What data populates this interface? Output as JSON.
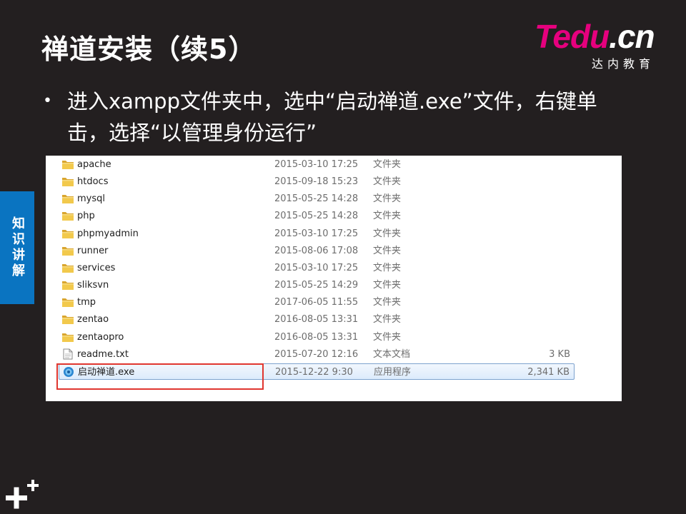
{
  "slide": {
    "title": "禅道安装（续5）",
    "bullet_text": "进入xampp文件夹中，选中“启动禅道.exe”文件，右键单击，选择“以管理身份运行”",
    "bullet_symbol": "•",
    "side_tab_label": "知识讲解"
  },
  "logo": {
    "main_part1": "T",
    "main_part2": "edu",
    "main_part3": ".cn",
    "subtitle": "达内教育",
    "colors": {
      "magenta": "#e6007e",
      "white": "#ffffff"
    }
  },
  "explorer": {
    "files": [
      {
        "name": "apache",
        "date": "2015-03-10 17:25",
        "type": "文件夹",
        "size": "",
        "icon": "folder-icon"
      },
      {
        "name": "htdocs",
        "date": "2015-09-18 15:23",
        "type": "文件夹",
        "size": "",
        "icon": "folder-icon"
      },
      {
        "name": "mysql",
        "date": "2015-05-25 14:28",
        "type": "文件夹",
        "size": "",
        "icon": "folder-icon"
      },
      {
        "name": "php",
        "date": "2015-05-25 14:28",
        "type": "文件夹",
        "size": "",
        "icon": "folder-icon"
      },
      {
        "name": "phpmyadmin",
        "date": "2015-03-10 17:25",
        "type": "文件夹",
        "size": "",
        "icon": "folder-icon"
      },
      {
        "name": "runner",
        "date": "2015-08-06 17:08",
        "type": "文件夹",
        "size": "",
        "icon": "folder-icon"
      },
      {
        "name": "services",
        "date": "2015-03-10 17:25",
        "type": "文件夹",
        "size": "",
        "icon": "folder-icon"
      },
      {
        "name": "sliksvn",
        "date": "2015-05-25 14:29",
        "type": "文件夹",
        "size": "",
        "icon": "folder-icon"
      },
      {
        "name": "tmp",
        "date": "2017-06-05 11:55",
        "type": "文件夹",
        "size": "",
        "icon": "folder-icon"
      },
      {
        "name": "zentao",
        "date": "2016-08-05 13:31",
        "type": "文件夹",
        "size": "",
        "icon": "folder-icon"
      },
      {
        "name": "zentaopro",
        "date": "2016-08-05 13:31",
        "type": "文件夹",
        "size": "",
        "icon": "folder-icon"
      },
      {
        "name": "readme.txt",
        "date": "2015-07-20 12:16",
        "type": "文本文档",
        "size": "3 KB",
        "icon": "text-file-icon"
      },
      {
        "name": "启动禅道.exe",
        "date": "2015-12-22 9:30",
        "type": "应用程序",
        "size": "2,341 KB",
        "icon": "app-icon",
        "selected": true
      }
    ],
    "highlight_color": "#e0362f",
    "selection_color": "#dcebfc"
  },
  "colors": {
    "background": "#231f20",
    "side_tab": "#0a74c1",
    "folder": "#e8b53c"
  }
}
